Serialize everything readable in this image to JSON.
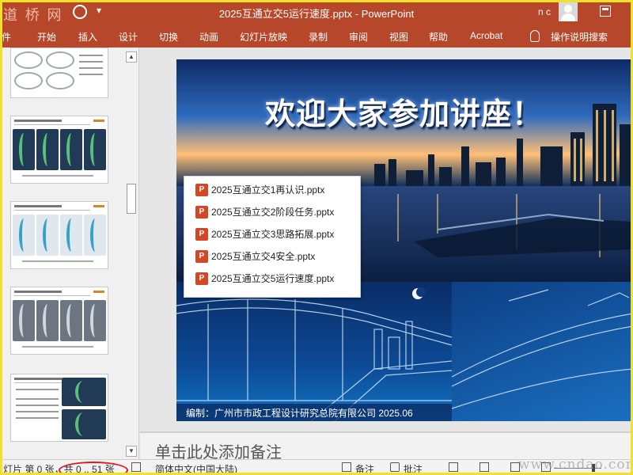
{
  "titlebar": {
    "logo": "道 桥 网",
    "title": "2025互通立交5运行速度.pptx  -  PowerPoint",
    "user": "n c"
  },
  "menu": {
    "items": [
      "件",
      "开始",
      "插入",
      "设计",
      "切换",
      "动画",
      "幻灯片放映",
      "录制",
      "审阅",
      "视图",
      "帮助",
      "Acrobat",
      "操作说明搜索"
    ]
  },
  "slide": {
    "heading": "欢迎大家参加讲座！",
    "credit": "编制：广州市市政工程设计研究总院有限公司   2025.06"
  },
  "popup": {
    "icon_letter": "P",
    "files": [
      "2025互通立交1再认识.pptx",
      "2025互通立交2阶段任务.pptx",
      "2025互通立交3思路拓展.pptx",
      "2025互通立交4安全.pptx",
      "2025互通立交5运行速度.pptx"
    ]
  },
  "notes": {
    "placeholder": "单击此处添加备注"
  },
  "status": {
    "slide_info": "灯片 第 0 张，共 0 .. 51 张",
    "language": "简体中文(中国大陆)",
    "notes_btn": "备注",
    "comments_btn": "批注",
    "watermark": "www.cndao.com"
  },
  "colors": {
    "accent": "#b7472a",
    "popup_icon": "#d24726",
    "annotation": "#e21818"
  }
}
